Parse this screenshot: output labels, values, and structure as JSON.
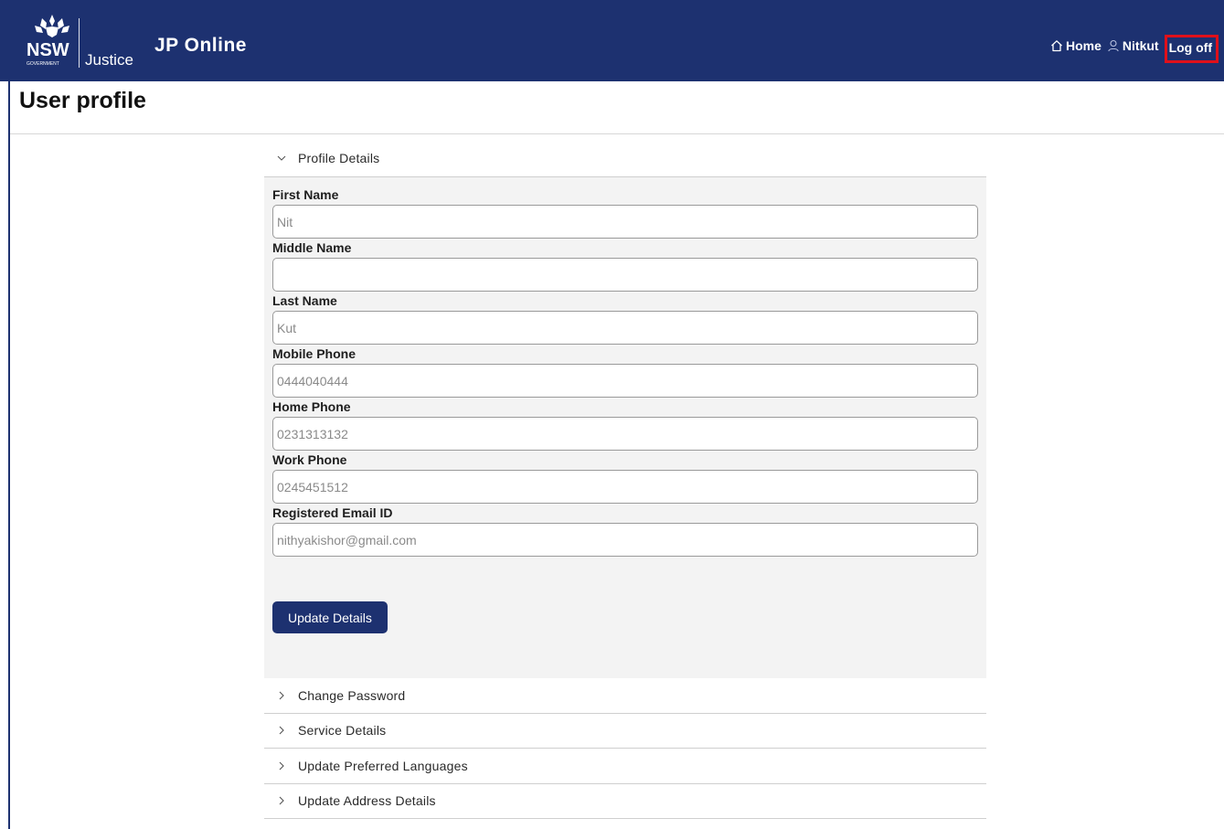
{
  "header": {
    "logo_text": "NSW",
    "logo_subtext": "GOVERNMENT",
    "department": "Justice",
    "app_title": "JP Online",
    "nav": {
      "home": "Home",
      "user": "Nitkut",
      "logoff": "Log off"
    }
  },
  "page": {
    "title": "User profile"
  },
  "sections": {
    "profile": {
      "heading": "Profile Details",
      "fields": [
        {
          "label": "First Name",
          "value": "",
          "placeholder": "Nit"
        },
        {
          "label": "Middle Name",
          "value": "",
          "placeholder": ""
        },
        {
          "label": "Last Name",
          "value": "",
          "placeholder": "Kut"
        },
        {
          "label": "Mobile Phone",
          "value": "",
          "placeholder": "0444040444"
        },
        {
          "label": "Home Phone",
          "value": "",
          "placeholder": "0231313132"
        },
        {
          "label": "Work Phone",
          "value": "",
          "placeholder": "0245451512"
        },
        {
          "label": "Registered Email ID",
          "value": "",
          "placeholder": "nithyakishor@gmail.com"
        }
      ],
      "submit_label": "Update Details"
    },
    "collapsed": [
      "Change Password",
      "Service Details",
      "Update Preferred Languages",
      "Update Address Details"
    ]
  },
  "colors": {
    "brand_navy": "#1d3170",
    "highlight_red": "#e0101a",
    "panel_bg": "#f3f3f3"
  },
  "icons": [
    "nsw-waratah-logo",
    "home-icon",
    "user-icon",
    "chevron-down-icon",
    "chevron-right-icon"
  ]
}
